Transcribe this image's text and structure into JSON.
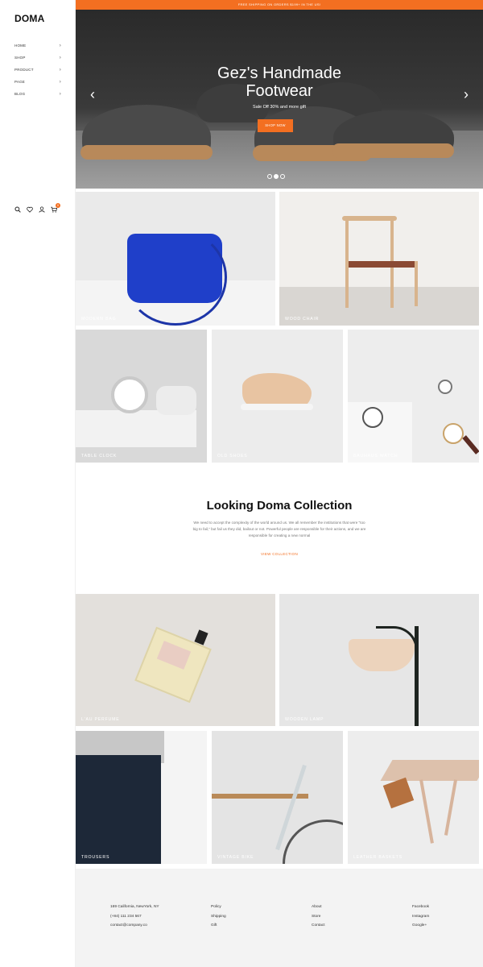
{
  "brand": {
    "logo": "DOMA",
    "accent": "#f36f21"
  },
  "sidebar": {
    "nav": [
      {
        "label": "HOME"
      },
      {
        "label": "SHOP"
      },
      {
        "label": "PRODUCT"
      },
      {
        "label": "PAGE"
      },
      {
        "label": "BLOG"
      }
    ],
    "icons": [
      "search-icon",
      "heart-icon",
      "user-icon",
      "cart-icon"
    ],
    "cart_count": "0"
  },
  "topbar": {
    "text": "FREE SHIPPING ON ORDERS $199+ IN THE US!"
  },
  "hero": {
    "title_line1": "Gez's Handmade",
    "title_line2": "Footwear",
    "subtitle": "Sale Off 30% and more gift",
    "button": "SHOP NOW",
    "slides": 3,
    "active_slide": 2
  },
  "tiles_top": [
    {
      "label": "MODERN BAG"
    },
    {
      "label": "WOOD CHAIR"
    },
    {
      "label": "TABLE CLOCK"
    },
    {
      "label": "OLD SHOES"
    },
    {
      "label": "BAUHAUS WATCH"
    }
  ],
  "collection": {
    "title": "Looking Doma Collection",
    "text": "We need to accept the complexity of the world around us. We all remember the institutions that were \"too big to fail,\" but fail us they did, bailout or not. Powerful people are responsible for their actions, and we are responsible for creating a new normal",
    "link": "VIEW COLLECTION"
  },
  "tiles_bottom": [
    {
      "label": "L'AU PERFUME"
    },
    {
      "label": "WOODEN LAMP"
    },
    {
      "label": "TROUSERS"
    },
    {
      "label": "VINTAGE BIKE"
    },
    {
      "label": "LEATHER BASKETS"
    }
  ],
  "footer": {
    "contact": [
      "169 California, NewYork, NY",
      "(+84) 111 234 567",
      "contact@company.co"
    ],
    "policies": [
      "Policy",
      "Shipping",
      "Gift"
    ],
    "company": [
      "About",
      "Store",
      "Contact"
    ],
    "social": [
      "Facebook",
      "Instagram",
      "Google+"
    ]
  }
}
